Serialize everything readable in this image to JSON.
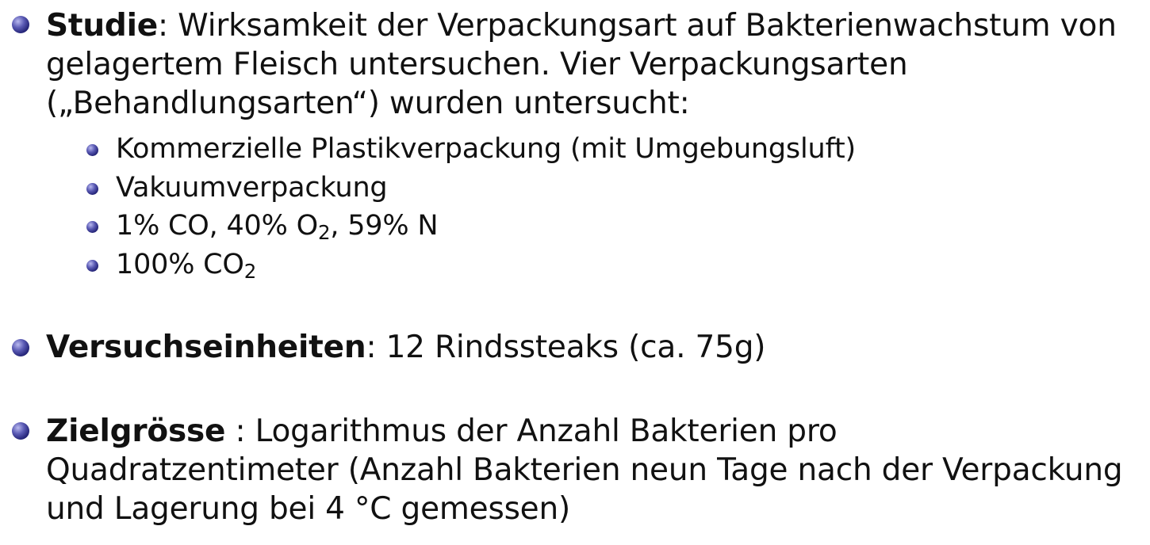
{
  "bullets": [
    {
      "label": "Studie",
      "text": ": Wirksamkeit der Verpackungsart auf Bakterienwachstum von gelagertem Fleisch untersuchen. Vier Verpackungsarten („Behandlungsarten“) wurden untersucht:",
      "subitems": [
        "Kommerzielle Plastikverpackung (mit Umgebungsluft)",
        "Vakuumverpackung",
        {
          "a": "1% CO, 40% O",
          "sub": "2",
          "b": ", 59% N"
        },
        {
          "a": "100% CO",
          "sub": "2",
          "b": ""
        }
      ]
    },
    {
      "label": "Versuchseinheiten",
      "text": ": 12 Rindssteaks (ca. 75g)"
    },
    {
      "label": "Zielgrösse",
      "text": " : Logarithmus der Anzahl Bakterien pro Quadratzentimeter (Anzahl Bakterien neun Tage nach der Verpackung und Lagerung bei 4 °C gemessen)"
    }
  ]
}
